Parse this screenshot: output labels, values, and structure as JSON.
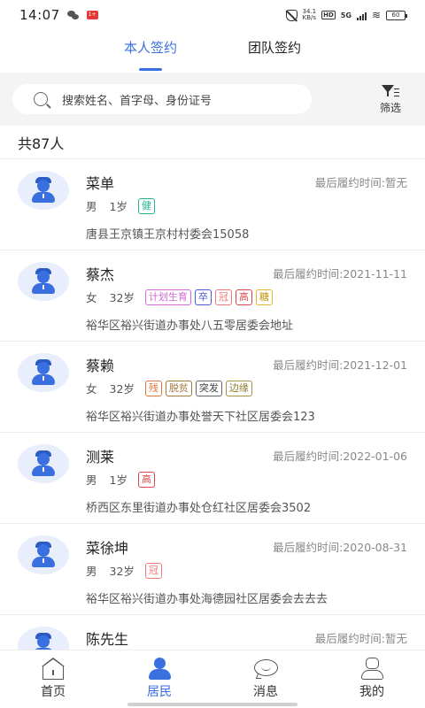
{
  "status_bar": {
    "time": "14:07",
    "notif_badge": "1+",
    "net_speed_top": "34.1",
    "net_speed_bottom": "KB/s",
    "hd_label": "HD",
    "network": "5G",
    "battery": "60"
  },
  "tabs": [
    {
      "label": "本人签约",
      "active": true
    },
    {
      "label": "团队签约",
      "active": false
    }
  ],
  "search": {
    "placeholder": "搜索姓名、首字母、身份证号",
    "filter_label": "筛选"
  },
  "count_label": "共87人",
  "residents": [
    {
      "name": "菜单",
      "last_time": "最后履约时间:暂无",
      "gender": "男",
      "age": "1岁",
      "tags": [
        {
          "text": "健",
          "color": "green"
        }
      ],
      "address": "唐县王京镇王京村村委会15058"
    },
    {
      "name": "蔡杰",
      "last_time": "最后履约时间:2021-11-11",
      "gender": "女",
      "age": "32岁",
      "tags": [
        {
          "text": "计划生育",
          "color": "pink"
        },
        {
          "text": "卒",
          "color": "blue"
        },
        {
          "text": "冠",
          "color": "lightred"
        },
        {
          "text": "高",
          "color": "red"
        },
        {
          "text": "糖",
          "color": "yellow"
        }
      ],
      "address": "裕华区裕兴街道办事处八五零居委会地址"
    },
    {
      "name": "蔡赖",
      "last_time": "最后履约时间:2021-12-01",
      "gender": "女",
      "age": "32岁",
      "tags": [
        {
          "text": "残",
          "color": "orange"
        },
        {
          "text": "脱贫",
          "color": "brown"
        },
        {
          "text": "突发",
          "color": "dark"
        },
        {
          "text": "边缘",
          "color": "olive"
        }
      ],
      "address": "裕华区裕兴街道办事处誉天下社区居委会123"
    },
    {
      "name": "测莱",
      "last_time": "最后履约时间:2022-01-06",
      "gender": "男",
      "age": "1岁",
      "tags": [
        {
          "text": "高",
          "color": "red"
        }
      ],
      "address": "桥西区东里街道办事处仓红社区居委会3502"
    },
    {
      "name": "菜徐坤",
      "last_time": "最后履约时间:2020-08-31",
      "gender": "男",
      "age": "32岁",
      "tags": [
        {
          "text": "冠",
          "color": "lightred"
        }
      ],
      "address": "裕华区裕兴街道办事处海德园社区居委会去去去"
    },
    {
      "name": "陈先生",
      "last_time": "最后履约时间:暂无",
      "gender": "",
      "age": "",
      "tags": [],
      "address": ""
    }
  ],
  "tabbar": [
    {
      "label": "首页",
      "icon": "home-icon",
      "active": false
    },
    {
      "label": "居民",
      "icon": "residents-icon",
      "active": true
    },
    {
      "label": "消息",
      "icon": "message-icon",
      "active": false
    },
    {
      "label": "我的",
      "icon": "profile-icon",
      "active": false
    }
  ],
  "colors": {
    "accent": "#3a6fe0"
  }
}
